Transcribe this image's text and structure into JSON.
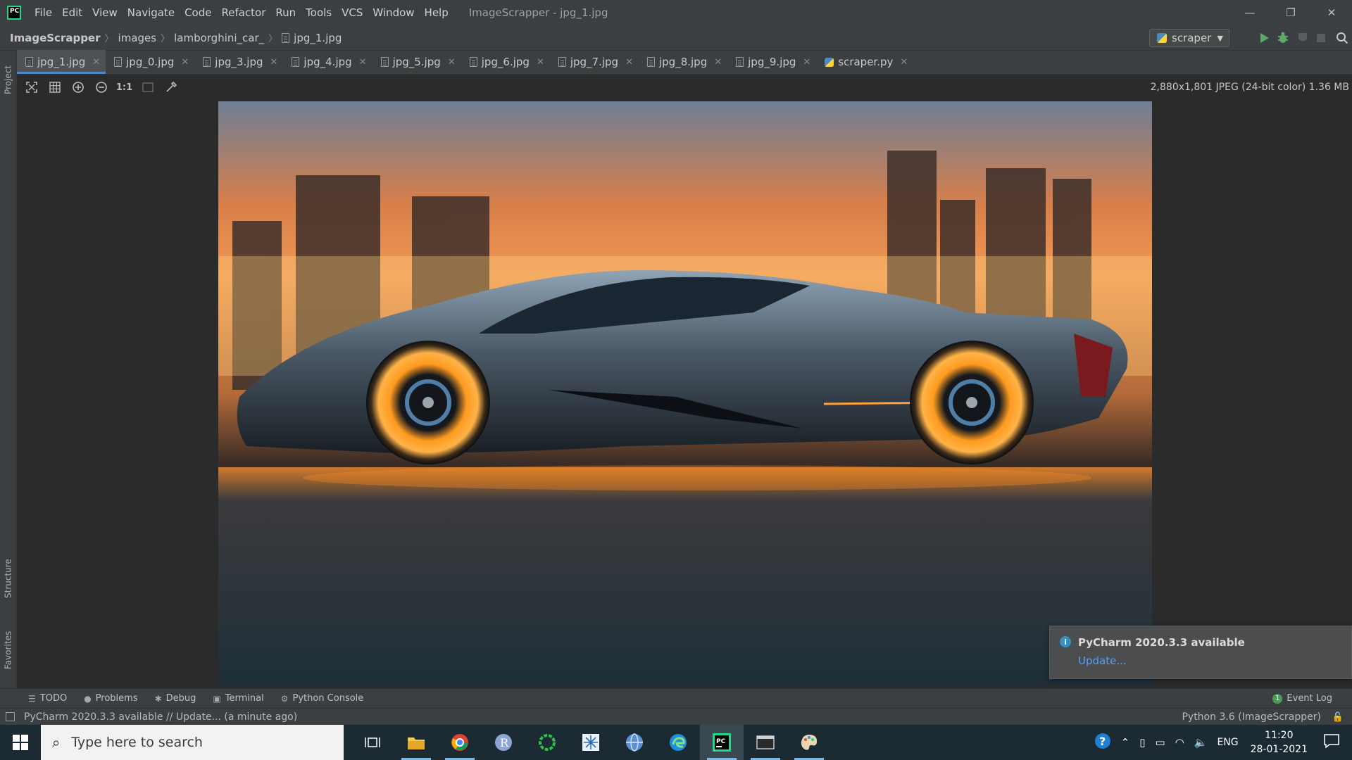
{
  "window": {
    "title": "ImageScrapper - jpg_1.jpg",
    "menu": [
      "File",
      "Edit",
      "View",
      "Navigate",
      "Code",
      "Refactor",
      "Run",
      "Tools",
      "VCS",
      "Window",
      "Help"
    ],
    "controls": {
      "minimize": "—",
      "restore": "❐",
      "close": "✕"
    }
  },
  "breadcrumb": [
    "ImageScrapper",
    "images",
    "lamborghini_car_",
    "jpg_1.jpg"
  ],
  "run_config": {
    "label": "scraper"
  },
  "tabs": [
    {
      "label": "jpg_1.jpg",
      "active": true,
      "type": "image"
    },
    {
      "label": "jpg_0.jpg",
      "active": false,
      "type": "image"
    },
    {
      "label": "jpg_3.jpg",
      "active": false,
      "type": "image"
    },
    {
      "label": "jpg_4.jpg",
      "active": false,
      "type": "image"
    },
    {
      "label": "jpg_5.jpg",
      "active": false,
      "type": "image"
    },
    {
      "label": "jpg_6.jpg",
      "active": false,
      "type": "image"
    },
    {
      "label": "jpg_7.jpg",
      "active": false,
      "type": "image"
    },
    {
      "label": "jpg_8.jpg",
      "active": false,
      "type": "image"
    },
    {
      "label": "jpg_9.jpg",
      "active": false,
      "type": "image"
    },
    {
      "label": "scraper.py",
      "active": false,
      "type": "python"
    }
  ],
  "image_toolbar": {
    "zoom_actual_label": "1:1",
    "info": "2,880x1,801 JPEG (24-bit color) 1.36 MB"
  },
  "side_tabs": {
    "project": "Project",
    "structure": "Structure",
    "favorites": "Favorites"
  },
  "bottom_tabs": [
    {
      "label": "TODO",
      "icon": "list-icon"
    },
    {
      "label": "Problems",
      "icon": "problems-icon"
    },
    {
      "label": "Debug",
      "icon": "bug-icon"
    },
    {
      "label": "Terminal",
      "icon": "terminal-icon"
    },
    {
      "label": "Python Console",
      "icon": "python-icon"
    }
  ],
  "event_log": {
    "label": "Event Log",
    "count": "1"
  },
  "notification": {
    "title": "PyCharm 2020.3.3 available",
    "link": "Update..."
  },
  "status": {
    "message": "PyCharm 2020.3.3 available // Update... (a minute ago)",
    "interpreter": "Python 3.6 (ImageScrapper)"
  },
  "taskbar": {
    "search_placeholder": "Type here to search",
    "time": "11:20",
    "date": "28-01-2021",
    "language": "ENG"
  },
  "colors": {
    "accent": "#4a88c7",
    "ide_bg": "#3c3f41",
    "editor_bg": "#2b2b2b",
    "link": "#589df6"
  }
}
